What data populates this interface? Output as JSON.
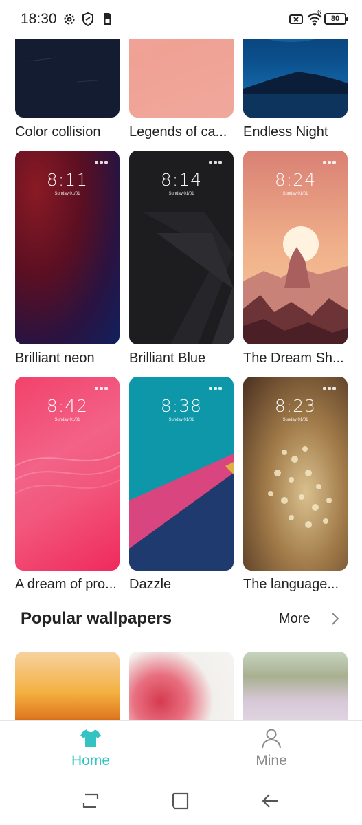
{
  "status_bar": {
    "time": "18:30",
    "battery": "80",
    "wifi_badge": "6",
    "icons": [
      "gear-icon",
      "shield-icon",
      "sim-card-icon",
      "no-sim-icon",
      "wifi-icon",
      "battery-icon"
    ]
  },
  "wallpaper_rows": [
    {
      "items": [
        {
          "label": "Color collision"
        },
        {
          "label": "Legends of ca..."
        },
        {
          "label": "Endless Night"
        }
      ]
    },
    {
      "items": [
        {
          "label": "Brilliant neon",
          "time": "8:11",
          "date": "Sunday 01/01"
        },
        {
          "label": "Brilliant Blue",
          "time": "8:14",
          "date": "Sunday 01/01"
        },
        {
          "label": "The Dream Sh...",
          "time": "8:24",
          "date": "Sunday 01/01"
        }
      ]
    },
    {
      "items": [
        {
          "label": "A dream of pro...",
          "time": "8:42",
          "date": "Sunday 01/01"
        },
        {
          "label": "Dazzle",
          "time": "8:38",
          "date": "Sunday 01/01"
        },
        {
          "label": "The language...",
          "time": "8:23",
          "date": "Sunday 01/01"
        }
      ]
    }
  ],
  "popular": {
    "title": "Popular wallpapers",
    "more_label": "More"
  },
  "bottom_nav": {
    "home_label": "Home",
    "mine_label": "Mine",
    "active": "Home",
    "accent_color": "#33c3c3"
  }
}
